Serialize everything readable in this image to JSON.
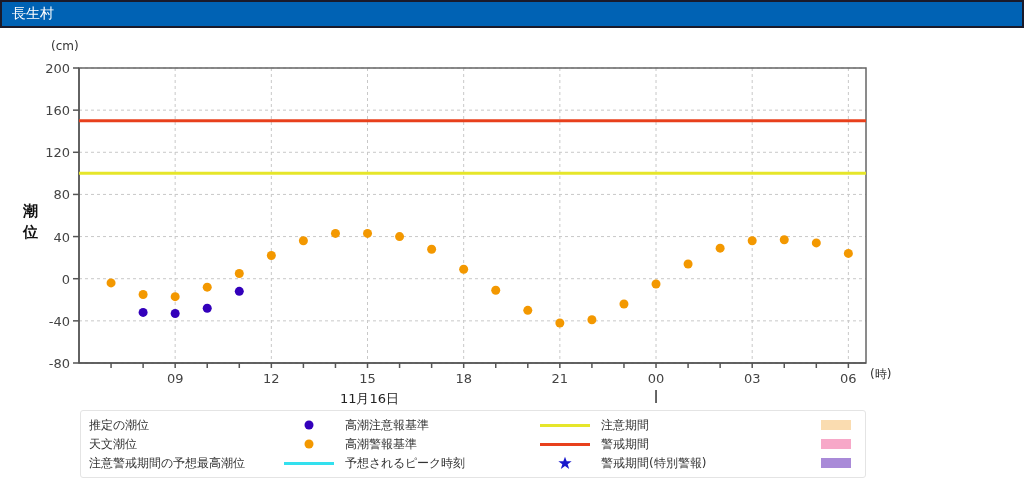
{
  "title": "長生村",
  "chart": {
    "next_day_tick_labels": [
      "00",
      "03",
      "06"
    ],
    "y_axis_title": "潮位",
    "y_unit": "(cm)",
    "x_unit": "(時)",
    "date_label": "11月16日",
    "chart_data": {
      "type": "scatter",
      "grid": true,
      "ylim": [
        -80,
        200
      ],
      "yticks": [
        -80,
        -40,
        0,
        40,
        80,
        120,
        160,
        200
      ],
      "xlim": [
        6,
        30.55
      ],
      "xticks": [
        {
          "value": 9,
          "label": "09"
        },
        {
          "value": 12,
          "label": "12"
        },
        {
          "value": 15,
          "label": "15"
        },
        {
          "value": 18,
          "label": "18"
        },
        {
          "value": 21,
          "label": "21"
        }
      ],
      "x": [
        7,
        8,
        9,
        10,
        11,
        12,
        13,
        14,
        15,
        16,
        17,
        18,
        19,
        20,
        21,
        22,
        23,
        24,
        25,
        26,
        27,
        28,
        29,
        30
      ],
      "series": [
        {
          "name": "推定の潮位",
          "color": "#3300bb",
          "values": [
            null,
            -32,
            -33,
            -28,
            -12,
            null,
            null,
            null,
            null,
            null,
            null,
            null,
            null,
            null,
            null,
            null,
            null,
            null,
            null,
            null,
            null,
            null,
            null,
            null
          ]
        },
        {
          "name": "天文潮位",
          "color": "#f39800",
          "values": [
            -4,
            -15,
            -17,
            -8,
            5,
            22,
            36,
            43,
            43,
            40,
            28,
            9,
            -11,
            -30,
            -42,
            -39,
            -24,
            -5,
            14,
            29,
            36,
            37,
            34,
            24
          ]
        }
      ],
      "ref_lines": [
        {
          "axis": "y",
          "value": 100,
          "label": "高潮注意報基準",
          "color": "#e6e62a"
        },
        {
          "axis": "y",
          "value": 150,
          "label": "高潮警報基準",
          "color": "#e8401c"
        }
      ]
    }
  },
  "legend": [
    {
      "label": "注意警戒期間の予想最高潮位",
      "kind": "line",
      "color": "#33e0ee"
    },
    {
      "label": "予想されるピーク時刻",
      "kind": "star",
      "color": "#1a1acc"
    },
    {
      "label": "注意期間",
      "kind": "swatch",
      "color": "#fadcb0"
    },
    {
      "label": "警戒期間",
      "kind": "swatch",
      "color": "#f7a8c8"
    },
    {
      "label": "警戒期間(特別警報)",
      "kind": "swatch",
      "color": "#a98ad8"
    }
  ]
}
